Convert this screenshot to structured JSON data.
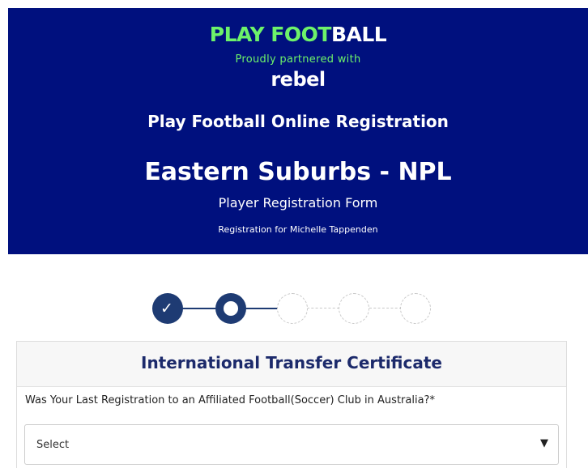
{
  "header": {
    "brand_play": "PLAY FOOT",
    "brand_ball": "BALL",
    "partner_text": "Proudly partnered with",
    "partner_logo": "rebel",
    "registration_title": "Play Football Online Registration",
    "club_name": "Eastern Suburbs - NPL",
    "form_name": "Player Registration Form",
    "registration_for": "Registration for Michelle Tappenden"
  },
  "stepper": {
    "total_steps": 5,
    "completed_steps": 1,
    "current_step": 2
  },
  "section": {
    "title": "International Transfer Certificate",
    "question": "Was Your Last Registration to an Affiliated Football(Soccer) Club in Australia?*",
    "select": {
      "value": "Select",
      "arrow_icon": "▼"
    }
  },
  "colors": {
    "header_bg": "#00107e",
    "brand_green": "#6df26a",
    "step_active": "#1e3b73",
    "section_title": "#1c2a6b"
  }
}
